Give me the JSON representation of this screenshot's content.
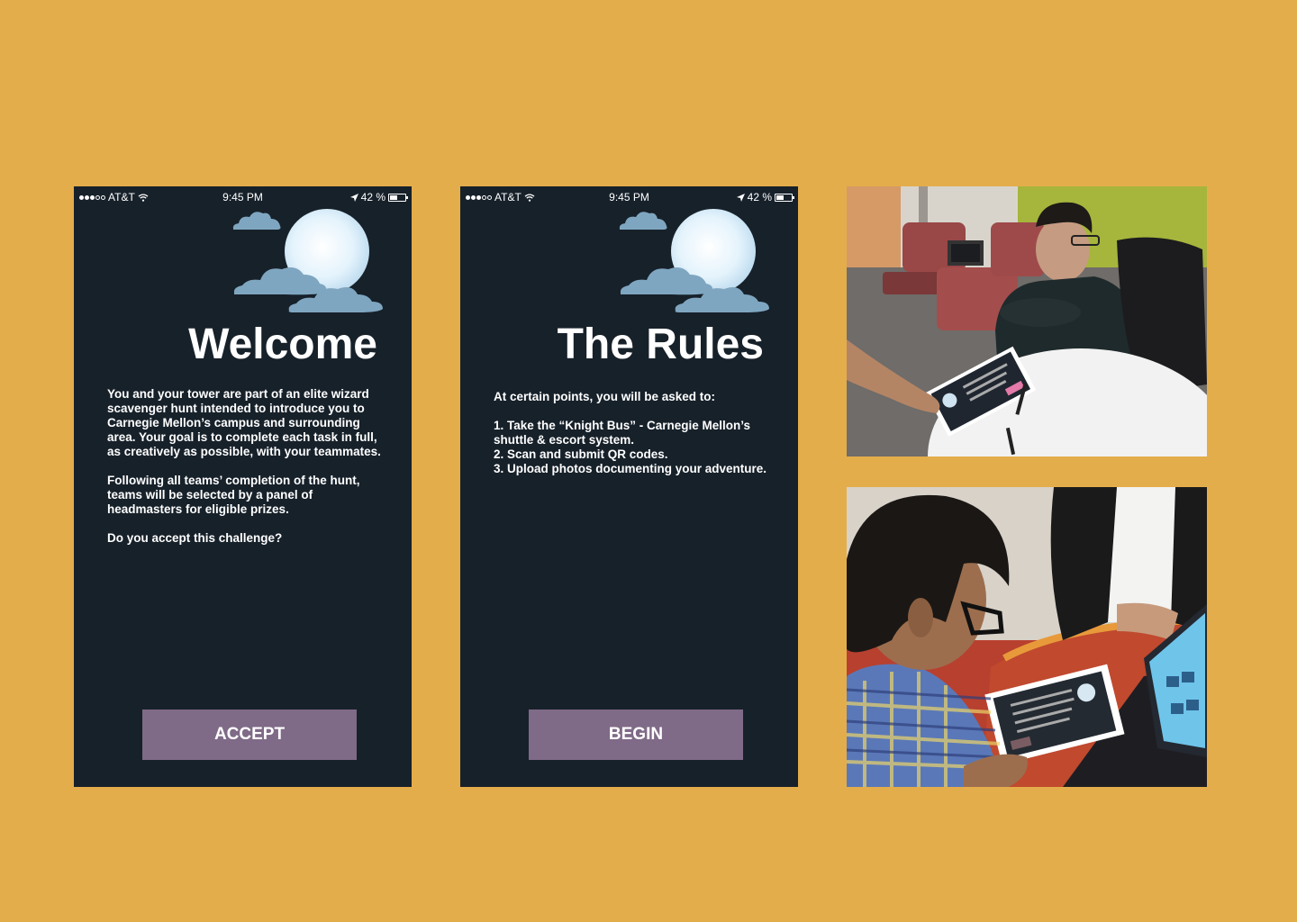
{
  "welcome_screen": {
    "status_bar": {
      "carrier": "AT&T",
      "time": "9:45 PM",
      "battery": "42 %"
    },
    "title": "Welcome",
    "paragraphs": [
      "You and your tower are part of an elite wizard scavenger hunt intended to introduce you to Carnegie Mellon’s campus and surrounding area. Your goal is to complete each task in full, as creatively as possible, with your teammates.",
      "Following all teams’ completion of the hunt, teams will be selected by a panel of headmasters for eligible prizes.",
      "Do you accept this challenge?"
    ],
    "button_label": "ACCEPT"
  },
  "rules_screen": {
    "status_bar": {
      "carrier": "AT&T",
      "time": "9:45 PM",
      "battery": "42 %"
    },
    "title": "The Rules",
    "intro": "At certain points, you will be asked to:",
    "rules": [
      "1. Take the “Knight Bus” - Carnegie Mellon’s shuttle & escort system.",
      "2. Scan and submit QR codes.",
      "3. Upload photos documenting your adventure."
    ],
    "button_label": "BEGIN"
  },
  "photos": {
    "photo_1": {
      "subject": "user-testing-photo-paper-prototype"
    },
    "photo_2": {
      "subject": "user-testing-photo-laptop"
    }
  },
  "colors": {
    "background": "#e4ad4b",
    "phone_background": "#17212a",
    "button": "#7f6a87",
    "cloud": "#7fa6c0",
    "moon": "#dff0fb"
  },
  "icons": [
    "signal-dots-icon",
    "wifi-icon",
    "location-arrow-icon",
    "battery-icon",
    "moon-icon",
    "cloud-icon"
  ]
}
